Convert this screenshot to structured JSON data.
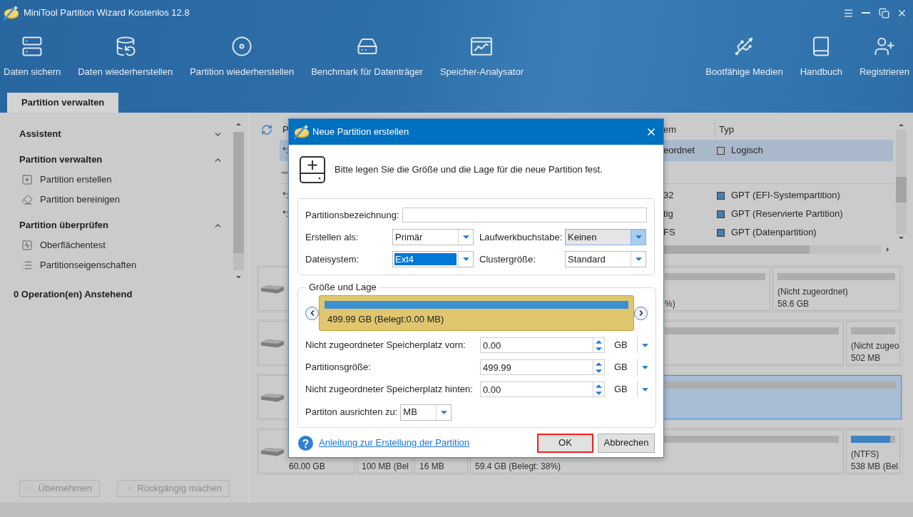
{
  "window": {
    "title": "MiniTool Partition Wizard Kostenlos 12.8"
  },
  "toolbar": {
    "left": [
      {
        "label": "Daten sichern"
      },
      {
        "label": "Daten wiederherstellen"
      },
      {
        "label": "Partition wiederherstellen"
      },
      {
        "label": "Benchmark für Datenträger"
      },
      {
        "label": "Speicher-Analysator"
      }
    ],
    "right": [
      {
        "label": "Bootfähige Medien"
      },
      {
        "label": "Handbuch"
      },
      {
        "label": "Registrieren"
      }
    ]
  },
  "tabs": [
    {
      "label": "Partition verwalten",
      "selected": true
    }
  ],
  "sidebar": {
    "sections": [
      {
        "title": "Assistent",
        "expanded": false
      },
      {
        "title": "Partition verwalten",
        "expanded": true,
        "items": [
          {
            "label": "Partition erstellen"
          },
          {
            "label": "Partition bereinigen"
          }
        ]
      },
      {
        "title": "Partition überprüfen",
        "expanded": true,
        "items": [
          {
            "label": "Oberflächentest"
          },
          {
            "label": "Partitionseigenschaften"
          }
        ]
      }
    ],
    "pending": "0 Operation(en) Anstehend",
    "buttons": [
      {
        "label": "Übernehmen",
        "disabled": true
      },
      {
        "label": "Rückgängig machen",
        "disabled": true
      }
    ]
  },
  "partition_table": {
    "columns": [
      "P",
      "em",
      "Typ"
    ],
    "rows": [
      {
        "kind": "partition",
        "selected": true,
        "column_1": "*:",
        "column_2": "eordnet",
        "type": "Logisch",
        "color": "#b4b4b4"
      },
      {
        "kind": "disk",
        "selected": false
      },
      {
        "kind": "partition",
        "selected": false,
        "column_1": "*:",
        "column_2": "32",
        "type": "GPT (EFI-Systempartition)",
        "color": "#3f7fb5"
      },
      {
        "kind": "partition",
        "selected": false,
        "column_1": "*:",
        "column_2": "tig",
        "type": "GPT (Reservierte Partition)",
        "color": "#3f7fb5"
      },
      {
        "kind": "partition",
        "selected": false,
        "column_2": "FS",
        "type": "GPT (Datenpartition)",
        "color": "#3f7fb5"
      }
    ]
  },
  "disk_map": {
    "disks": [
      {
        "partitions": [
          {
            "size": "%)",
            "selected": false
          },
          {
            "label": "(Nicht zugeordnet)",
            "size": "58.6 GB",
            "selected": false
          }
        ]
      },
      {
        "partitions": [
          {
            "selected": false
          },
          {
            "label": "(Nicht zugeo",
            "size": "502 MB",
            "selected": false
          }
        ]
      },
      {
        "partitions": [
          {
            "selected": true
          }
        ]
      },
      {
        "size": "60.00 GB",
        "partitions": [
          {
            "size": "100 MB (Bel",
            "selected": false
          },
          {
            "size": "16 MB",
            "selected": false
          },
          {
            "size": "59.4 GB (Belegt: 38%)",
            "selected": false
          },
          {
            "label": "(NTFS)",
            "size": "538 MB (Bel",
            "level": 0.89,
            "selected": false
          }
        ]
      }
    ]
  },
  "dialog": {
    "title": "Neue Partition erstellen",
    "intro": "Bitte legen Sie die Größe und die Lage für die neue Partition fest.",
    "name_field": {
      "label": "Partitionsbezeichnung:"
    },
    "selects": [
      {
        "label": "Erstellen als:",
        "value": "Primär",
        "hovered": false,
        "focused": false
      },
      {
        "label": "Laufwerkbuchstabe:",
        "value": "Keinen",
        "hovered": true,
        "focused": false
      },
      {
        "label": "Dateisystem:",
        "value": "Ext4",
        "hovered": false,
        "focused": true
      },
      {
        "label": "Clustergröße:",
        "value": "Standard",
        "hovered": false,
        "focused": false
      }
    ],
    "size_location": {
      "title": "Größe und Lage",
      "bar_label": "499.99 GB (Belegt:0.00 MB)",
      "fields": [
        {
          "label": "Nicht zugeordneter Speicherplatz vorn:",
          "value": "0.00",
          "unit": "GB"
        },
        {
          "label": "Partitionsgröße:",
          "value": "499.99",
          "unit": "GB"
        },
        {
          "label": "Nicht zugeordneter Speicherplatz hinten:",
          "value": "0.00",
          "unit": "GB"
        }
      ],
      "align": {
        "label": "Partiton ausrichten zu:",
        "value": "MB"
      }
    },
    "help_link": "Anleitung zur Erstellung der Partition",
    "buttons": [
      {
        "label": "OK",
        "highlighted": true
      },
      {
        "label": "Abbrechen",
        "highlighted": false
      }
    ]
  }
}
